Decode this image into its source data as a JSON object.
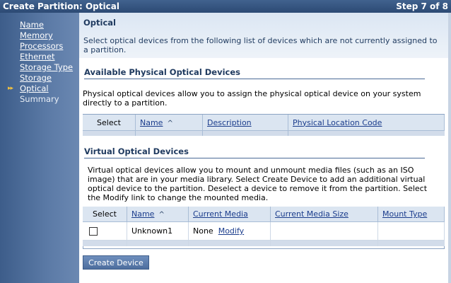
{
  "titlebar": {
    "title": "Create Partition: Optical",
    "step": "Step 7 of 8"
  },
  "sidebar": {
    "current_marker": "▸▸",
    "items": [
      {
        "label": "Name"
      },
      {
        "label": "Memory"
      },
      {
        "label": "Processors"
      },
      {
        "label": "Ethernet"
      },
      {
        "label": "Storage Type"
      },
      {
        "label": "Storage"
      },
      {
        "label": "Optical"
      },
      {
        "label": "Summary"
      }
    ]
  },
  "page": {
    "title": "Optical",
    "description": "Select optical devices from the following list of devices which are not currently assigned to a partition."
  },
  "physical": {
    "heading": "Available Physical Optical Devices",
    "description": "Physical optical devices allow you to assign the physical optical device on your system directly to a partition.",
    "columns": {
      "select": "Select",
      "name": "Name",
      "description": "Description",
      "location": "Physical Location Code"
    }
  },
  "virtual": {
    "heading": "Virtual Optical Devices",
    "description": "Virtual optical devices allow you to mount and unmount media files (such as an ISO image) that are in your media library. Select Create Device to add an additional virtual optical device to the partition. Deselect a device to remove it from the partition. Select the Modify link to change the mounted media.",
    "columns": {
      "select": "Select",
      "name": "Name",
      "media": "Current Media",
      "media_size": "Current Media Size",
      "mount_type": "Mount Type"
    },
    "rows": [
      {
        "name": "Unknown1",
        "media": "None",
        "modify": "Modify",
        "media_size": "",
        "mount_type": ""
      }
    ],
    "create_button": "Create Device"
  }
}
